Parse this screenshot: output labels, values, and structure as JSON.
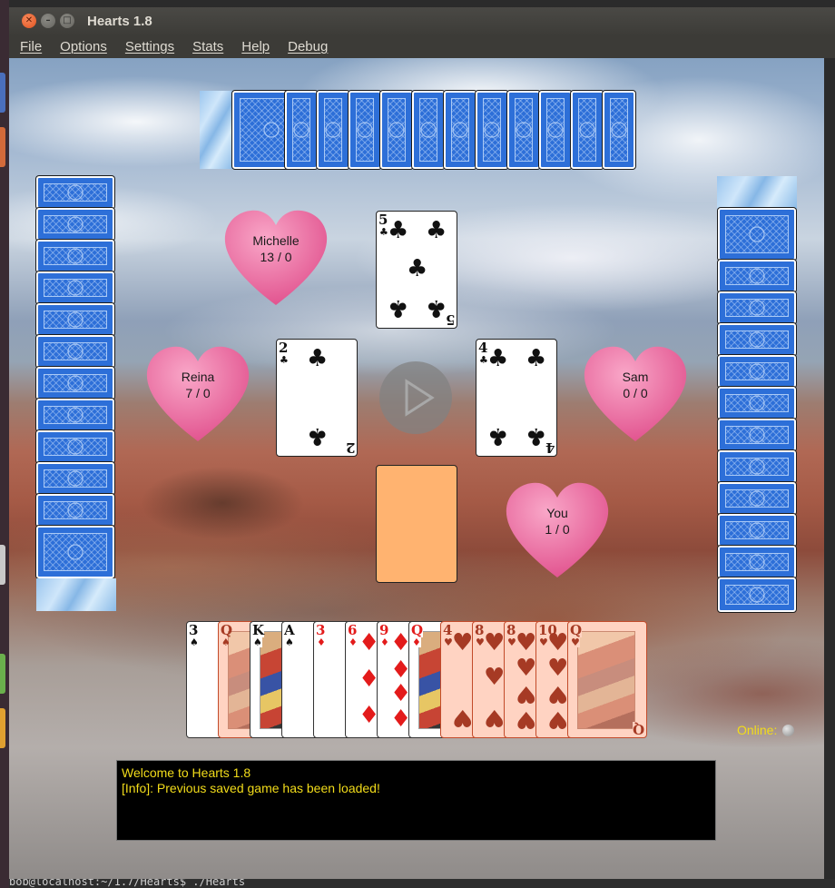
{
  "window": {
    "title": "Hearts 1.8"
  },
  "menu": [
    "File",
    "Options",
    "Settings",
    "Stats",
    "Help",
    "Debug"
  ],
  "players": {
    "north": {
      "name": "Michelle",
      "score": "13 / 0"
    },
    "west": {
      "name": "Reina",
      "score": "7 / 0"
    },
    "east": {
      "name": "Sam",
      "score": "0 / 0"
    },
    "south": {
      "name": "You",
      "score": "1 / 0"
    }
  },
  "table": {
    "north_card": {
      "rank": "5",
      "suit": "♣"
    },
    "west_card": {
      "rank": "2",
      "suit": "♣"
    },
    "east_card": {
      "rank": "4",
      "suit": "♣"
    }
  },
  "hand": [
    {
      "rank": "3",
      "suit": "♠",
      "color": "black",
      "faded": false
    },
    {
      "rank": "Q",
      "suit": "♠",
      "color": "black",
      "faded": true
    },
    {
      "rank": "K",
      "suit": "♠",
      "color": "black",
      "faded": false
    },
    {
      "rank": "A",
      "suit": "♠",
      "color": "black",
      "faded": false
    },
    {
      "rank": "3",
      "suit": "♦",
      "color": "red",
      "faded": false
    },
    {
      "rank": "6",
      "suit": "♦",
      "color": "red",
      "faded": false
    },
    {
      "rank": "9",
      "suit": "♦",
      "color": "red",
      "faded": false
    },
    {
      "rank": "Q",
      "suit": "♦",
      "color": "red",
      "faded": false
    },
    {
      "rank": "4",
      "suit": "♥",
      "color": "red",
      "faded": true
    },
    {
      "rank": "8",
      "suit": "♥",
      "color": "red",
      "faded": true
    },
    {
      "rank": "8",
      "suit": "♥",
      "color": "red",
      "faded": true
    },
    {
      "rank": "10",
      "suit": "♥",
      "color": "red",
      "faded": true
    },
    {
      "rank": "Q",
      "suit": "♥",
      "color": "red",
      "faded": true
    }
  ],
  "status": {
    "online_label": "Online:"
  },
  "log": [
    "Welcome to Hearts 1.8",
    "[Info]: Previous saved game has been loaded!"
  ],
  "terminal": {
    "text": "bob@localhost:~/1.7/Hearts$ ./Hearts"
  },
  "colors": {
    "heart_pink": "#e8679a",
    "card_back": "#2d6fd8",
    "log_text": "#f2dc1a",
    "empty_slot": "#ffb370"
  }
}
